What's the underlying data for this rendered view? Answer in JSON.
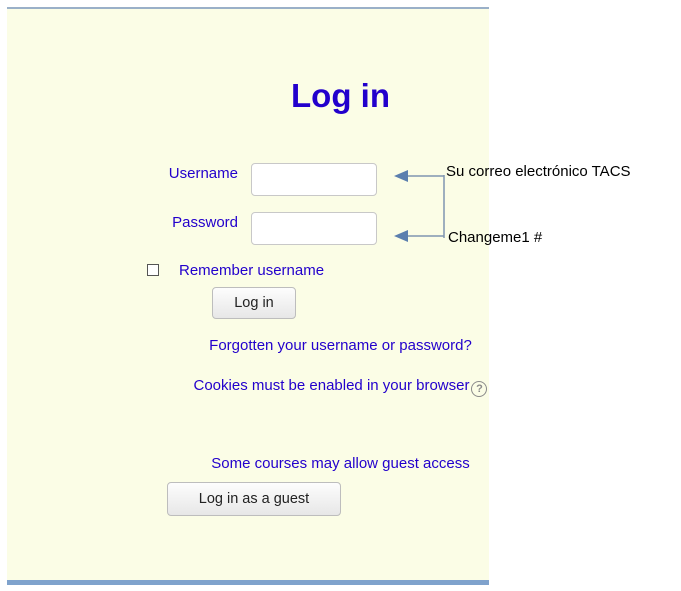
{
  "form": {
    "title": "Log in",
    "username_label": "Username",
    "password_label": "Password",
    "username_value": "",
    "password_value": "",
    "remember_label": "Remember username",
    "remember_checked": false,
    "login_button": "Log in",
    "forgot_link": "Forgotten your username or password?",
    "cookies_text": "Cookies must be enabled in your browser",
    "help_icon": "?",
    "guest_text": "Some courses may allow guest access",
    "guest_button": "Log in as a guest"
  },
  "annotations": {
    "username_note": "Su correo electrónico TACS",
    "password_note": "Changeme1 #"
  },
  "colors": {
    "panel_background": "#fbfde6",
    "link_text": "#2200cc",
    "panel_border": "#7fa2cc"
  }
}
